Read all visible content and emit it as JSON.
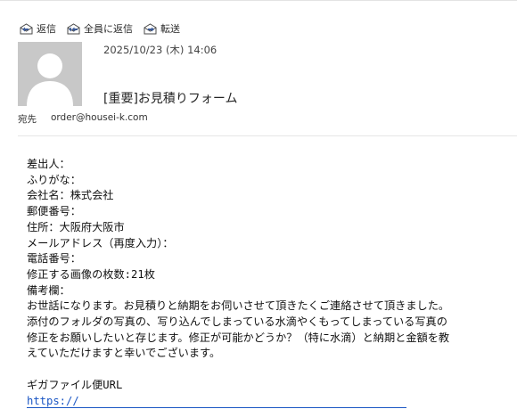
{
  "toolbar": {
    "reply_label": "返信",
    "reply_all_label": "全員に返信",
    "forward_label": "転送",
    "icon_color": "#3c5a96"
  },
  "header": {
    "date": "2025/10/23 (木) 14:06",
    "subject": "[重要]お見積りフォーム",
    "to_label": "宛先",
    "to_address": "order@housei-k.com"
  },
  "body": {
    "lines": [
      "差出人：",
      "ふりがな：",
      "会社名：株式会社",
      "郵便番号：",
      "住所：大阪府大阪市",
      "メールアドレス（再度入力）：",
      "電話番号：",
      "修正する画像の枚数:21枚",
      "備考欄："
    ],
    "message": [
      "お世話になります。お見積りと納期をお伺いさせて頂きたくご連絡させて頂きました。",
      "添付のフォルダの写真の、写り込んでしまっている水滴やくもってしまっている写真の",
      "修正をお願いしたいと存じます。修正が可能かどうか？（特に水滴）と納期と金額を教",
      "えていただけますと幸いでございます。"
    ],
    "gigafile_label": "ギガファイル便URL",
    "link_text": "https://"
  },
  "colors": {
    "link": "#1a56c4",
    "avatar_bg": "#c8c8c8",
    "divider": "#e6e6e6"
  }
}
